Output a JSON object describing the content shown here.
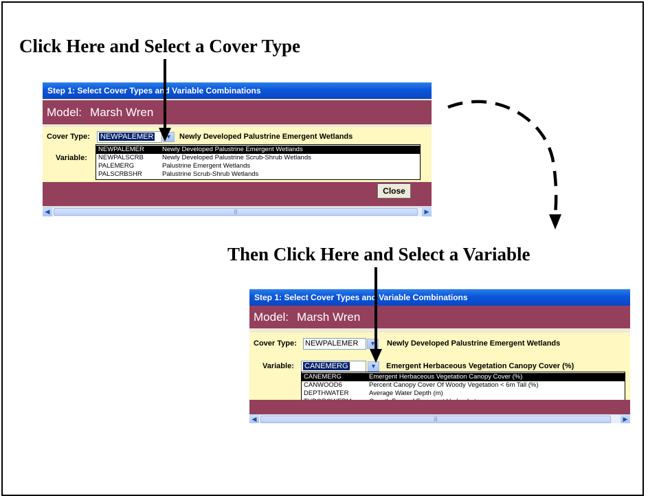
{
  "headings": {
    "first": "Click Here and Select a Cover Type",
    "second": "Then Click Here and Select a Variable"
  },
  "window1": {
    "title": "Step 1: Select Cover Types and Variable Combinations",
    "model_label": "Model:",
    "model_name": "Marsh Wren",
    "cover_type_label": "Cover Type:",
    "cover_type_value": "NEWPALEMER",
    "cover_type_desc": "Newly Developed Palustrine Emergent Wetlands",
    "variable_label": "Variable:",
    "dropdown_items": [
      {
        "code": "NEWPALEMER",
        "desc": "Newly Developed Palustrine Emergent Wetlands"
      },
      {
        "code": "NEWPALSCRB",
        "desc": "Newly Developed Palustrine Scrub-Shrub Wetlands"
      },
      {
        "code": "PALEMERG",
        "desc": "Palustrine Emergent Wetlands"
      },
      {
        "code": "PALSCRBSHR",
        "desc": "Palustrine Scrub-Shrub Wetlands"
      }
    ],
    "close_label": "Close"
  },
  "window2": {
    "title": "Step 1: Select Cover Types and Variable Combinations",
    "model_label": "Model:",
    "model_name": "Marsh Wren",
    "cover_type_label": "Cover Type:",
    "cover_type_value": "NEWPALEMER",
    "cover_type_desc": "Newly Developed Palustrine Emergent Wetlands",
    "variable_label": "Variable:",
    "variable_value": "CANEMERG",
    "variable_desc": "Emergent Herbaceous Vegetation Canopy Cover  (%)",
    "dropdown_items": [
      {
        "code": "CANEMERG",
        "desc": "Emergent Herbaceous Vegetation Canopy Cover  (%)"
      },
      {
        "code": "CANWOOD6",
        "desc": "Percent Canopy Cover Of Woody Vegetation < 6m  Tall (%)"
      },
      {
        "code": "DEPTHWATER",
        "desc": "Average Water Depth  (m)"
      },
      {
        "code": "TYPGROWFRM",
        "desc": "Growth Form of Emergent Hydrophytes"
      }
    ]
  },
  "colors": {
    "titlebar": "#0b55d9",
    "model_band": "#943f5c",
    "panel": "#fff8c0",
    "selection": "#0a246a"
  }
}
